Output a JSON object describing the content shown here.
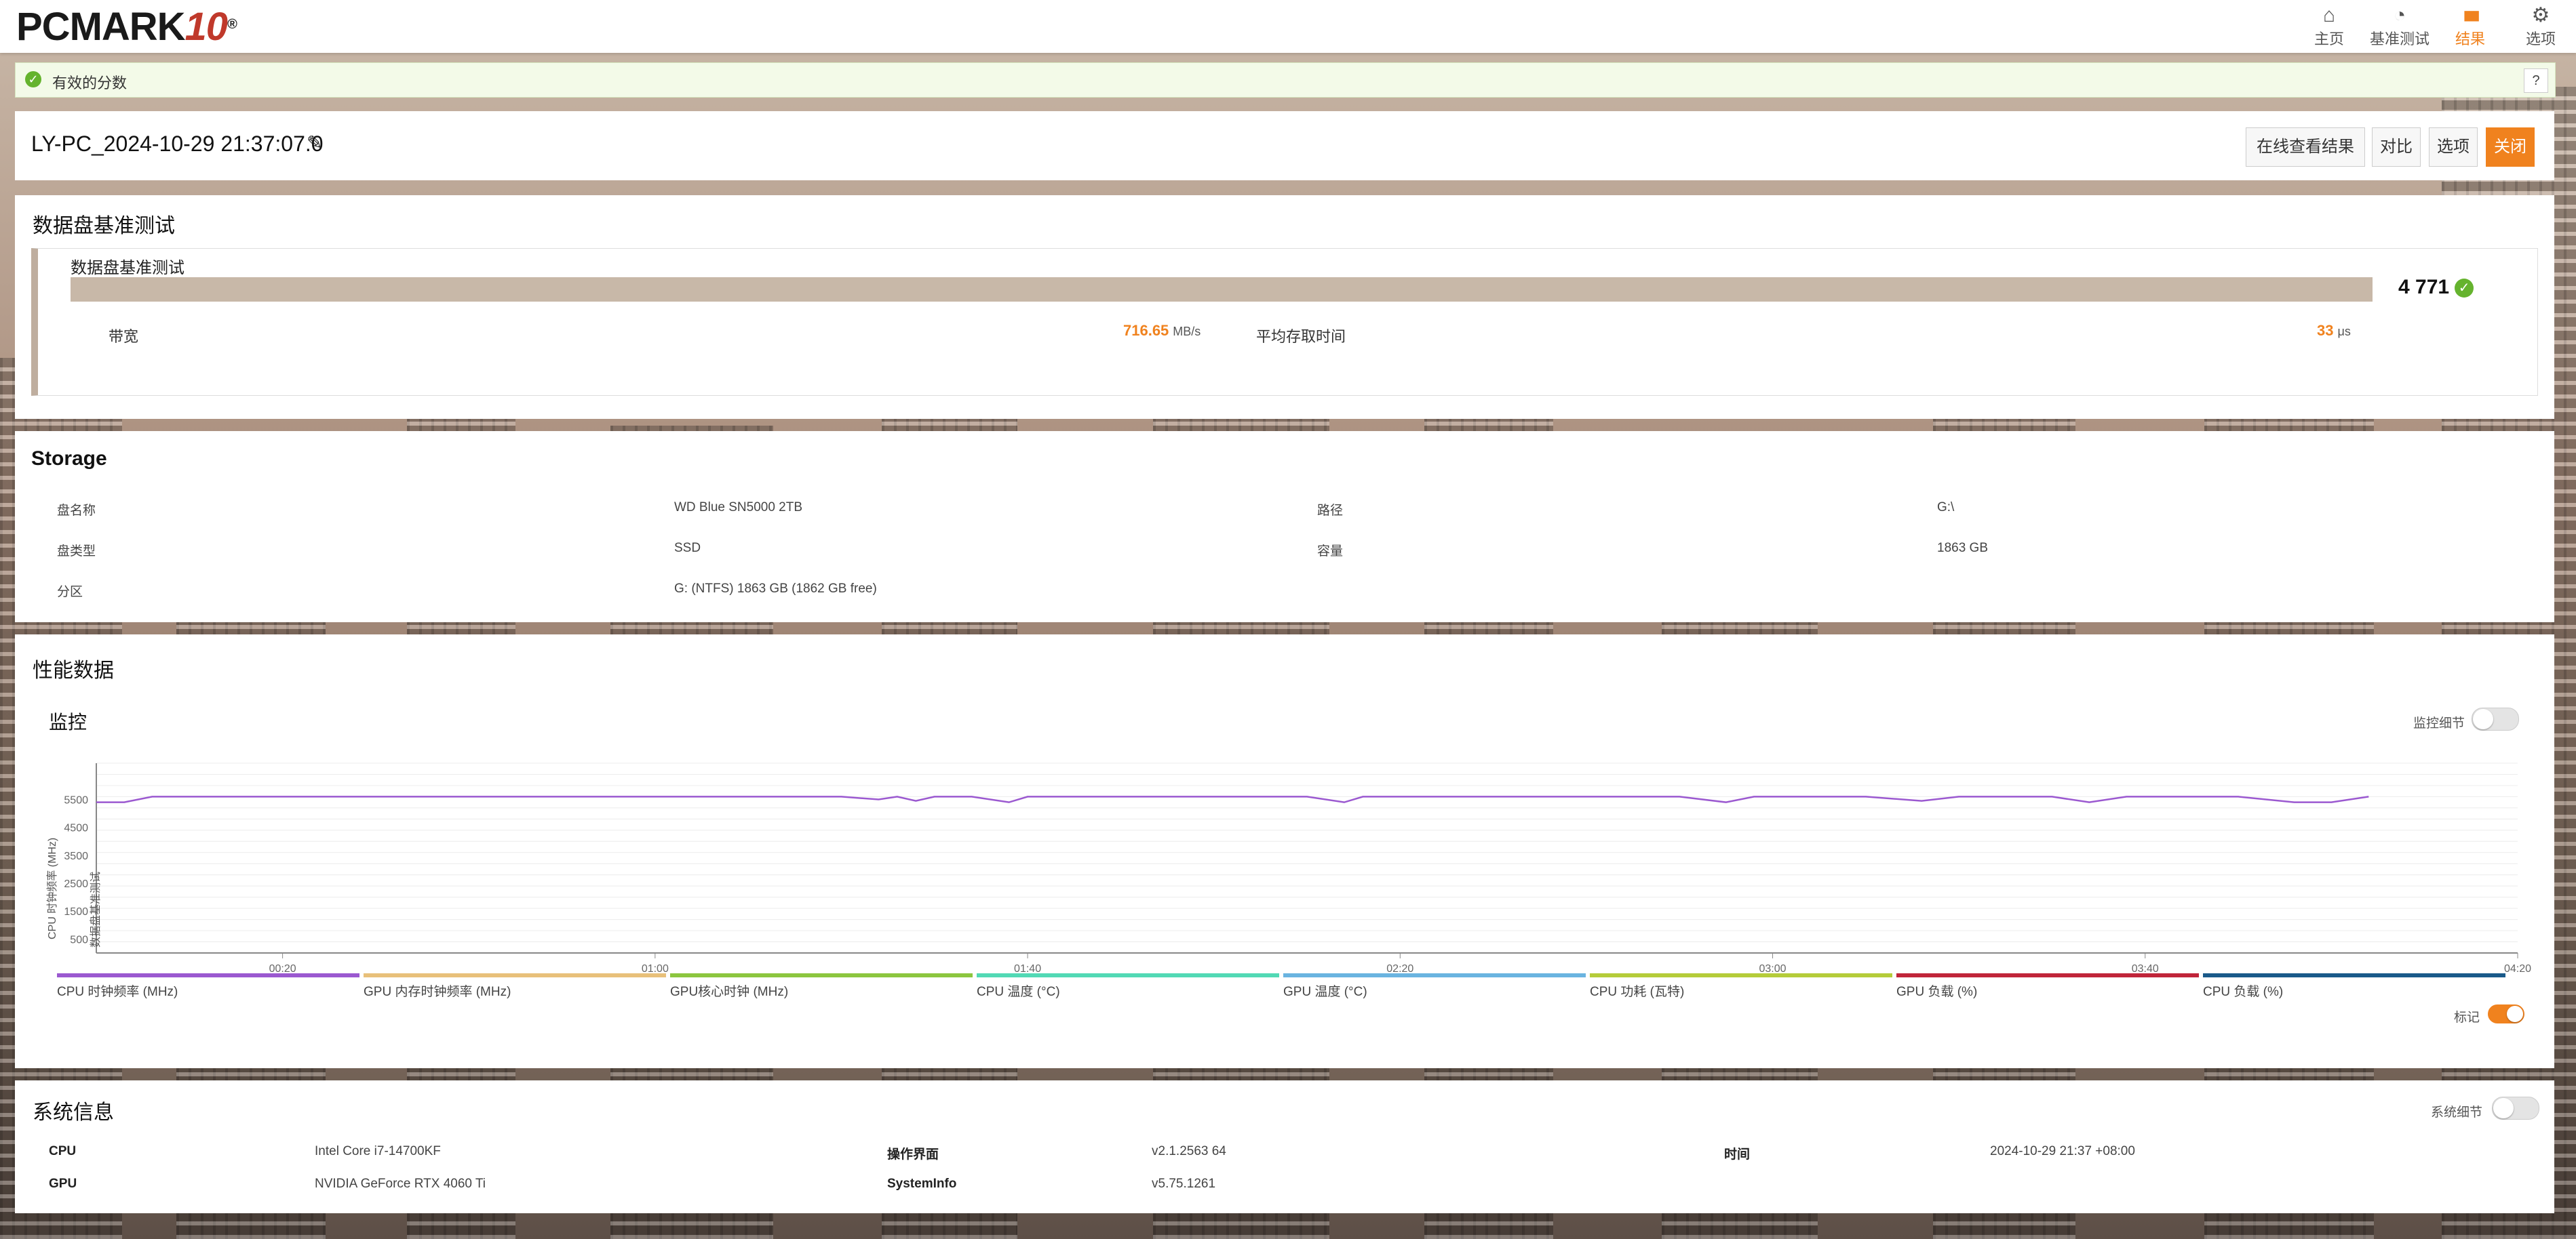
{
  "app": {
    "logo_main": "PCMARK",
    "logo_ten": "10",
    "logo_reg": "®"
  },
  "nav": [
    {
      "label": "主页",
      "icon": "home-icon",
      "glyph": "⌂"
    },
    {
      "label": "基准测试",
      "icon": "gauge-icon",
      "glyph": "◔"
    },
    {
      "label": "结果",
      "icon": "bar-chart-icon",
      "glyph": "▮▮▮",
      "active": true
    },
    {
      "label": "选项",
      "icon": "gear-icon",
      "glyph": "⚙"
    }
  ],
  "banner": {
    "text": "有效的分数",
    "help": "?"
  },
  "result": {
    "name": "LY-PC_2024-10-29 21:37:07.0",
    "buttons": {
      "view_online": "在线查看结果",
      "compare": "对比",
      "options": "选项",
      "close": "关闭"
    }
  },
  "benchmark": {
    "section_title": "数据盘基准测试",
    "sub_title": "数据盘基准测试",
    "score": "4 771",
    "bandwidth_label": "带宽",
    "bandwidth_value": "716.65",
    "bandwidth_unit": "MB/s",
    "access_label": "平均存取时间",
    "access_value": "33",
    "access_unit": "μs"
  },
  "storage": {
    "title": "Storage",
    "rows": [
      {
        "k1": "盘名称",
        "v1": "WD Blue SN5000 2TB",
        "k2": "路径",
        "v2": "G:\\"
      },
      {
        "k1": "盘类型",
        "v1": "SSD",
        "k2": "容量",
        "v2": "1863 GB"
      },
      {
        "k1": "分区",
        "v1": "G: (NTFS) 1863 GB (1862 GB free)",
        "k2": "",
        "v2": ""
      }
    ]
  },
  "performance": {
    "title": "性能数据",
    "monitor_title": "监控",
    "monitor_detail_label": "监控细节",
    "marker_label": "标记",
    "legend": [
      {
        "label": "CPU 时钟频率 (MHz)",
        "color": "#9b59d0"
      },
      {
        "label": "GPU 内存时钟频率 (MHz)",
        "color": "#e8c07a"
      },
      {
        "label": "GPU核心时钟 (MHz)",
        "color": "#8cc63f"
      },
      {
        "label": "CPU 温度 (°C)",
        "color": "#52d9b5"
      },
      {
        "label": "GPU 温度 (°C)",
        "color": "#6ab4e0"
      },
      {
        "label": "CPU 功耗 (瓦特)",
        "color": "#b5cc3a"
      },
      {
        "label": "GPU 负载 (%)",
        "color": "#c0253a"
      },
      {
        "label": "CPU 负载 (%)",
        "color": "#1a5a8a"
      }
    ]
  },
  "chart_data": {
    "type": "line",
    "ylabel": "CPU 时钟频率 (MHz)",
    "y_marker_label": "数据盘基准测试",
    "yticks": [
      500,
      1500,
      2500,
      3500,
      4500,
      5500
    ],
    "ylim": [
      0,
      6800
    ],
    "x_tick_labels": [
      "00:20",
      "01:00",
      "01:40",
      "02:20",
      "03:00",
      "03:40",
      "04:20"
    ],
    "x_tick_seconds": [
      20,
      60,
      100,
      140,
      180,
      220,
      260
    ],
    "xlim": [
      0,
      260
    ],
    "grid": true,
    "series": [
      {
        "name": "CPU 时钟频率 (MHz)",
        "color": "#9b59d0",
        "x": [
          0,
          3,
          6,
          10,
          20,
          30,
          40,
          50,
          60,
          70,
          80,
          84,
          86,
          88,
          90,
          94,
          98,
          100,
          104,
          110,
          120,
          130,
          134,
          136,
          140,
          150,
          160,
          170,
          175,
          178,
          180,
          190,
          196,
          200,
          210,
          214,
          218,
          220,
          230,
          236,
          240,
          244
        ],
        "y": [
          5400,
          5400,
          5600,
          5600,
          5600,
          5600,
          5600,
          5600,
          5600,
          5600,
          5600,
          5500,
          5600,
          5450,
          5600,
          5600,
          5400,
          5600,
          5600,
          5600,
          5600,
          5600,
          5400,
          5600,
          5600,
          5600,
          5600,
          5600,
          5400,
          5600,
          5600,
          5600,
          5450,
          5600,
          5600,
          5400,
          5600,
          5600,
          5600,
          5400,
          5400,
          5600
        ]
      }
    ]
  },
  "system": {
    "title": "系统信息",
    "detail_label": "系统细节",
    "rows": [
      {
        "k1": "CPU",
        "v1": "Intel Core i7-14700KF",
        "k2": "操作界面",
        "v2": "v2.1.2563 64",
        "k3": "时间",
        "v3": "2024-10-29 21:37 +08:00"
      },
      {
        "k1": "GPU",
        "v1": "NVIDIA GeForce RTX 4060 Ti",
        "k2": "SystemInfo",
        "v2": "v5.75.1261",
        "k3": "",
        "v3": ""
      }
    ]
  }
}
